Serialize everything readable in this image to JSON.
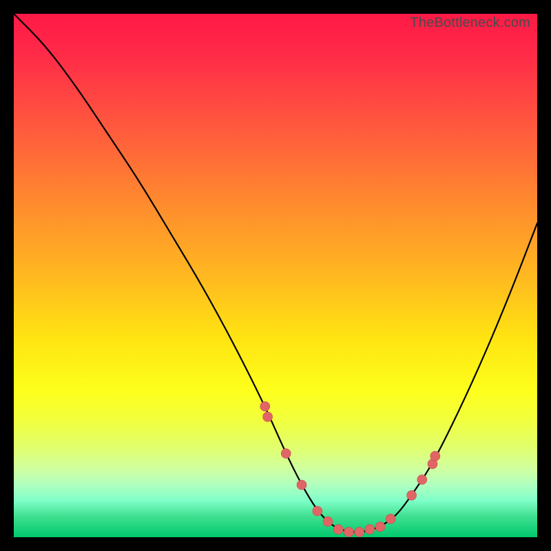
{
  "watermark": "TheBottleneck.com",
  "chart_data": {
    "type": "line",
    "title": "",
    "xlabel": "",
    "ylabel": "",
    "xlim": [
      0,
      100
    ],
    "ylim": [
      0,
      100
    ],
    "series": [
      {
        "name": "bottleneck-curve",
        "x": [
          0,
          6,
          12,
          18,
          24,
          30,
          36,
          42,
          48,
          52,
          55,
          58,
          61,
          64,
          67,
          70,
          73,
          76,
          80,
          85,
          90,
          95,
          100
        ],
        "y": [
          100,
          94,
          86,
          77,
          68,
          58,
          48,
          37,
          25,
          16,
          10,
          5,
          2,
          1,
          1,
          2,
          4,
          8,
          14,
          24,
          35,
          47,
          60
        ]
      }
    ],
    "markers": {
      "name": "highlight-points",
      "x": [
        48,
        48.5,
        52,
        55,
        58,
        60,
        62,
        64,
        66,
        68,
        70,
        72,
        76,
        78,
        80,
        80.5
      ],
      "y": [
        25,
        23,
        16,
        10,
        5,
        3,
        1.5,
        1,
        1,
        1.5,
        2,
        3.5,
        8,
        11,
        14,
        15.5
      ]
    },
    "background_gradient": {
      "top": "#ff1946",
      "mid": "#ffe412",
      "bottom": "#00c96e"
    }
  }
}
